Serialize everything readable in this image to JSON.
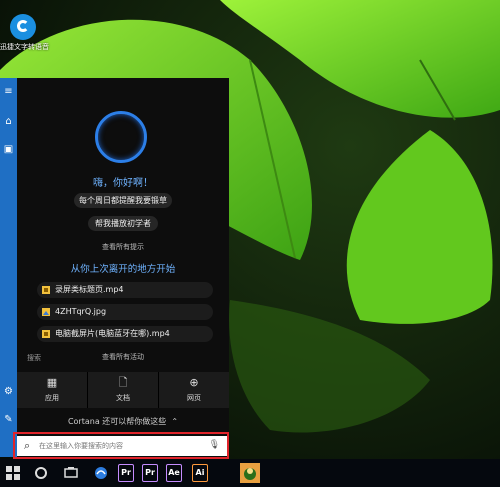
{
  "desktop": {
    "icon_label": "迅捷文字转语音",
    "icon_name": "app-shortcut-icon"
  },
  "cortana": {
    "greeting": "嗨，你好啊！",
    "suggestions": [
      "每个周日都提醒我要锻草",
      "帮我播放初学者"
    ],
    "view_all_tips": "查看所有提示",
    "section_title": "从你上次离开的地方开始",
    "recent_files": [
      {
        "name": "录屏类标题页.mp4",
        "icon": "video-file-icon",
        "color": "#f2c13d"
      },
      {
        "name": "4ZHTqrQ.jpg",
        "icon": "image-file-icon",
        "color": "#f2c13d"
      },
      {
        "name": "电脑截屏片(电脑蓝牙在哪).mp4",
        "icon": "video-file-icon",
        "color": "#f2c13d"
      }
    ],
    "search_header": "搜索",
    "view_all_activity": "查看所有活动",
    "categories": [
      {
        "label": "应用",
        "icon": "apps-icon",
        "glyph": "▦"
      },
      {
        "label": "文档",
        "icon": "document-icon",
        "glyph": "🗋"
      },
      {
        "label": "网页",
        "icon": "globe-icon",
        "glyph": "⊕"
      }
    ],
    "more_help": "Cortana 还可以帮你做这些",
    "accent": "#2c7fe8"
  },
  "search": {
    "placeholder": "在这里输入你要搜索的内容"
  },
  "taskbar": {
    "apps": [
      {
        "label": "Pr",
        "color": "#2a1459"
      },
      {
        "label": "Pr",
        "color": "#2a1459"
      },
      {
        "label": "Ae",
        "color": "#2a1459"
      },
      {
        "label": "Ai",
        "color": "#2a1459"
      }
    ]
  }
}
